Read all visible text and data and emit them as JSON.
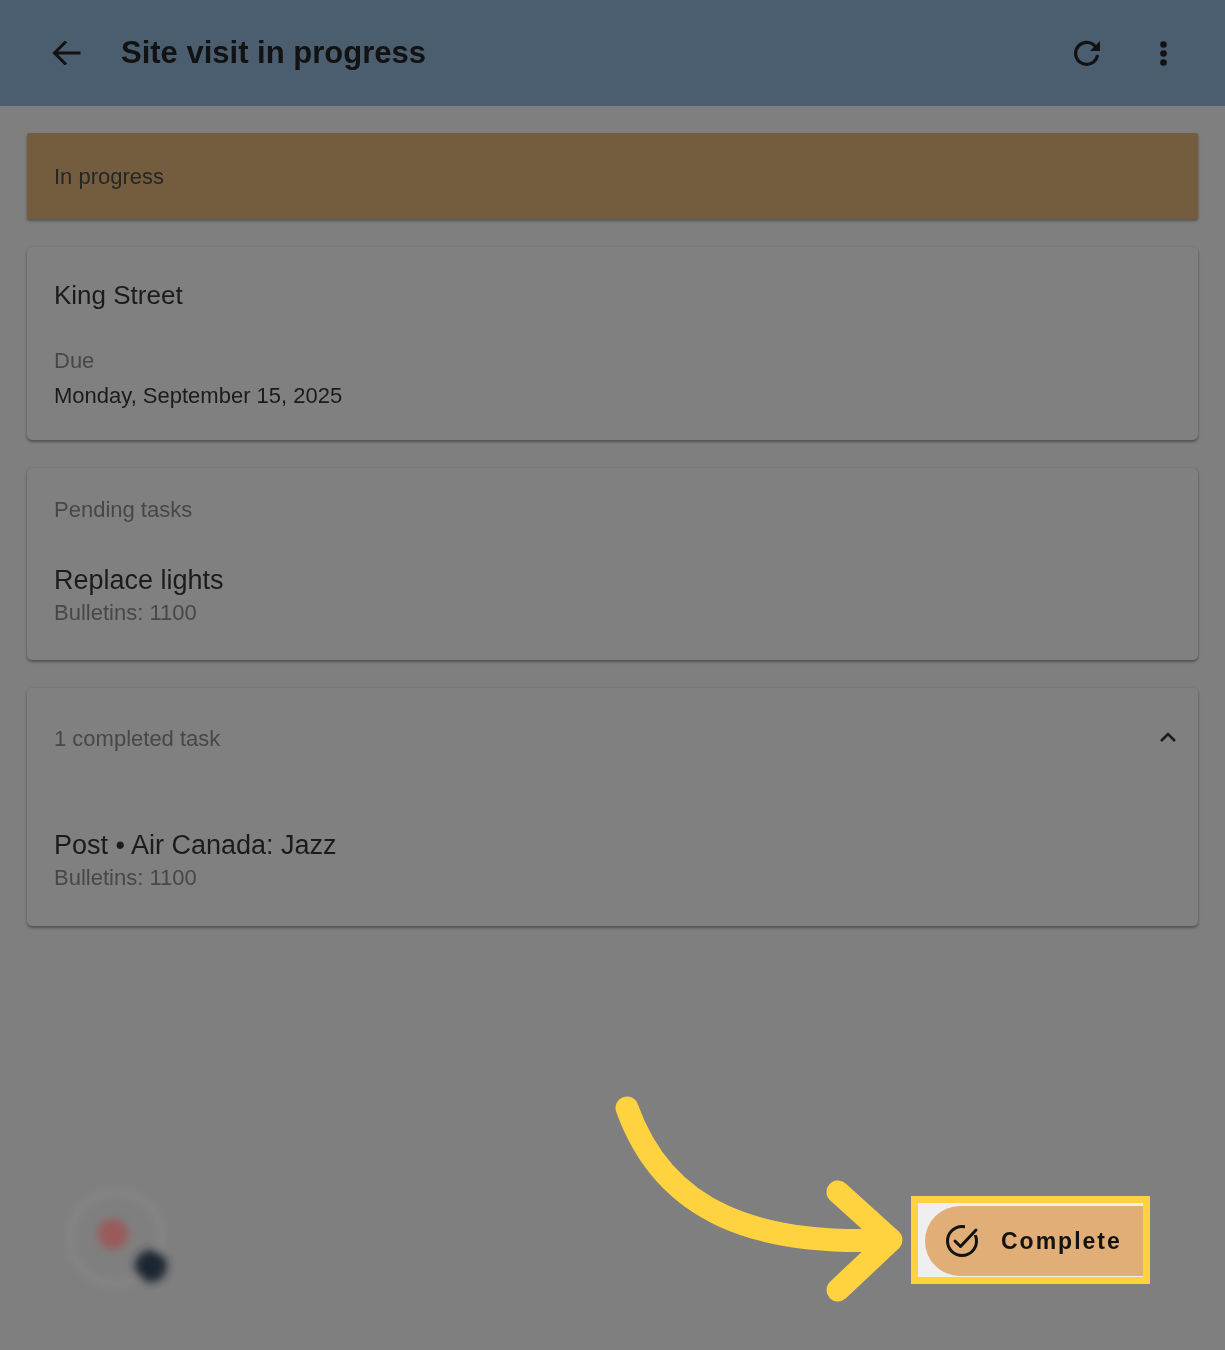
{
  "header": {
    "title": "Site visit in progress"
  },
  "status_banner": {
    "label": "In progress"
  },
  "site_card": {
    "name": "King Street",
    "due_label": "Due",
    "due_date": "Monday, September 15, 2025"
  },
  "pending_tasks": {
    "heading": "Pending tasks",
    "tasks": [
      {
        "title": "Replace lights",
        "subtitle": "Bulletins: 1100"
      }
    ]
  },
  "completed_tasks": {
    "heading": "1 completed task",
    "expanded": true,
    "tasks": [
      {
        "title": "Post • Air Canada: Jazz",
        "subtitle": "Bulletins: 1100"
      }
    ]
  },
  "complete_button": {
    "label": "Complete"
  }
}
